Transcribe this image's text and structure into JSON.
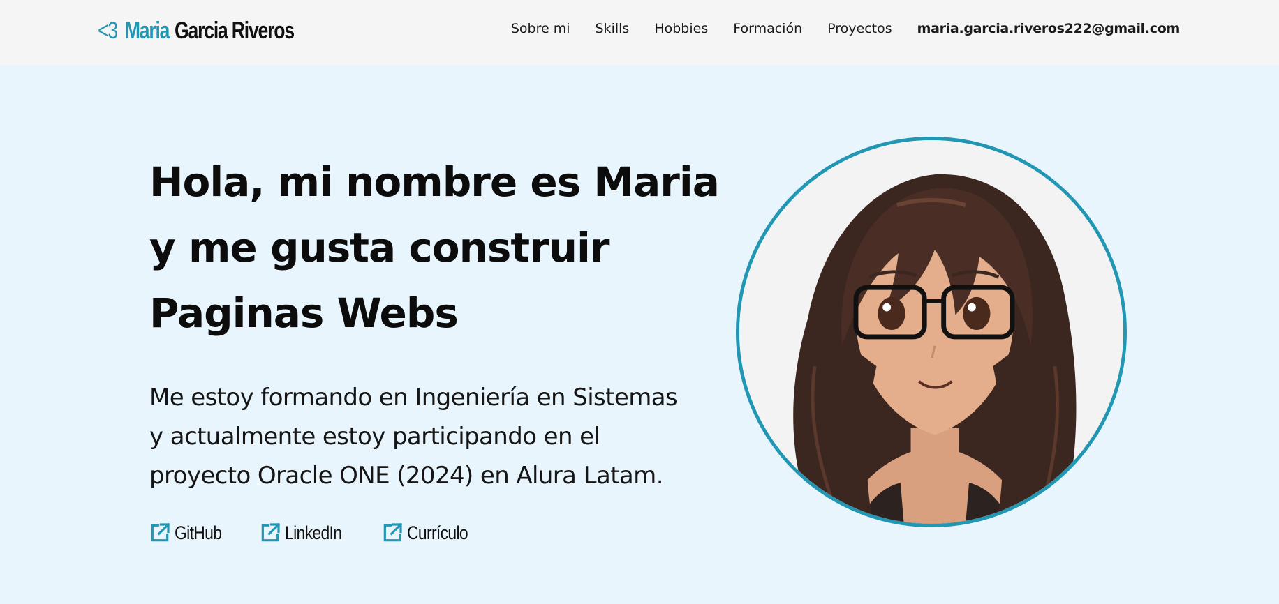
{
  "header": {
    "logo": {
      "heart": "<3",
      "first_name": "Maria",
      "last_name": "Garcia Riveros"
    },
    "nav": [
      {
        "label": "Sobre mi"
      },
      {
        "label": "Skills"
      },
      {
        "label": "Hobbies"
      },
      {
        "label": "Formación"
      },
      {
        "label": "Proyectos"
      }
    ],
    "email": "maria.garcia.riveros222@gmail.com"
  },
  "hero": {
    "headline_lines": [
      "Hola, mi nombre es Maria",
      "y me gusta construir",
      "Paginas Webs"
    ],
    "intro_lines": [
      "Me estoy formando en Ingeniería en Sistemas",
      "y actualmente estoy participando en el",
      "proyecto Oracle ONE (2024) en Alura Latam."
    ],
    "links": [
      {
        "label": "GitHub",
        "icon": "external-link-icon"
      },
      {
        "label": "LinkedIn",
        "icon": "external-link-icon"
      },
      {
        "label": "Currículo",
        "icon": "external-link-icon"
      }
    ],
    "avatar": {
      "icon": "anime-girl-avatar-illustration"
    }
  },
  "colors": {
    "accent": "#2297b3",
    "header_bg": "#f5f5f5",
    "hero_bg": "#e9f5fc",
    "text": "#111111"
  }
}
